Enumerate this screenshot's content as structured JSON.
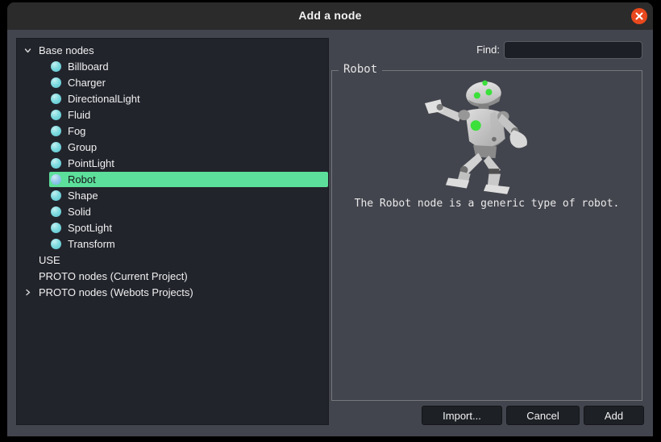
{
  "window": {
    "title": "Add a node"
  },
  "colors": {
    "dialog_bg": "#43454e",
    "titlebar_bg": "#2b2b2b",
    "tree_bg": "#22242c",
    "selection_green": "#5cdf9a",
    "node_icon_cyan": "#7fdbe0",
    "close_button_orange": "#e8481d"
  },
  "tree": {
    "items": [
      {
        "label": "Base nodes",
        "level": 0,
        "chevron": "down"
      },
      {
        "label": "Billboard",
        "level": 1,
        "icon": "node"
      },
      {
        "label": "Charger",
        "level": 1,
        "icon": "node"
      },
      {
        "label": "DirectionalLight",
        "level": 1,
        "icon": "node"
      },
      {
        "label": "Fluid",
        "level": 1,
        "icon": "node"
      },
      {
        "label": "Fog",
        "level": 1,
        "icon": "node"
      },
      {
        "label": "Group",
        "level": 1,
        "icon": "node"
      },
      {
        "label": "PointLight",
        "level": 1,
        "icon": "node"
      },
      {
        "label": "Robot",
        "level": 1,
        "icon": "node",
        "selected": true
      },
      {
        "label": "Shape",
        "level": 1,
        "icon": "node"
      },
      {
        "label": "Solid",
        "level": 1,
        "icon": "node"
      },
      {
        "label": "SpotLight",
        "level": 1,
        "icon": "node"
      },
      {
        "label": "Transform",
        "level": 1,
        "icon": "node"
      },
      {
        "label": "USE",
        "level": 0
      },
      {
        "label": "PROTO nodes (Current Project)",
        "level": 0
      },
      {
        "label": "PROTO nodes (Webots Projects)",
        "level": 0,
        "chevron": "right"
      }
    ]
  },
  "find": {
    "label": "Find:",
    "value": ""
  },
  "preview": {
    "group_title": "Robot",
    "description": "The Robot node is a generic type of robot.",
    "image": "robot-3d-render"
  },
  "footer": {
    "import_label": "Import...",
    "cancel_label": "Cancel",
    "add_label": "Add"
  }
}
